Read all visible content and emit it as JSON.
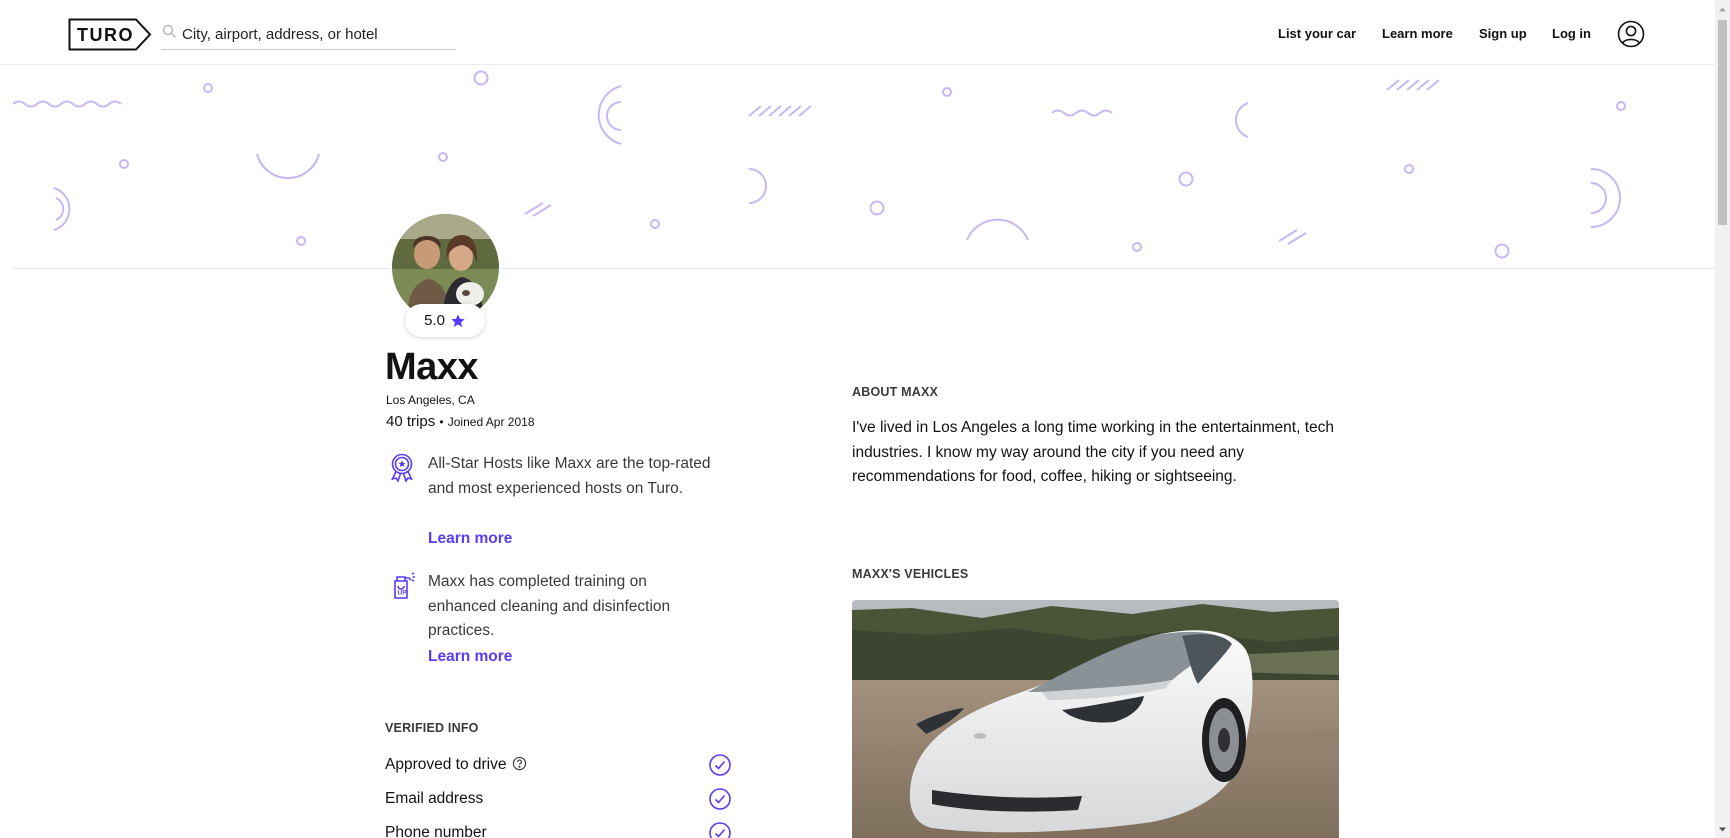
{
  "header": {
    "logo_text": "TURO",
    "search_placeholder": "City, airport, address, or hotel",
    "nav": {
      "list_car": "List your car",
      "learn_more": "Learn more",
      "sign_up": "Sign up",
      "log_in": "Log in"
    }
  },
  "host": {
    "rating": "5.0",
    "name": "Maxx",
    "location": "Los Angeles, CA",
    "trips": "40 trips",
    "separator": "•",
    "joined": "Joined Apr 2018",
    "badges": [
      {
        "icon": "all-star-ribbon-icon",
        "text": "All-Star Hosts like Maxx are the top-rated and most experienced hosts on Turo.",
        "link": "Learn more"
      },
      {
        "icon": "cleaning-spray-icon",
        "text": "Maxx has completed training on enhanced cleaning and disinfection practices.",
        "link": "Learn more"
      }
    ]
  },
  "verified": {
    "label": "VERIFIED INFO",
    "items": [
      {
        "label": "Approved to drive",
        "has_help": true
      },
      {
        "label": "Email address",
        "has_help": false
      },
      {
        "label": "Phone number",
        "has_help": false
      }
    ]
  },
  "about": {
    "label": "ABOUT MAXX",
    "text": "I've lived in Los Angeles a long time working in the entertainment, tech industries. I know my way around the city if you need any recommendations for food, coffee, hiking or sightseeing."
  },
  "vehicles": {
    "label": "MAXX'S VEHICLES"
  },
  "colors": {
    "accent": "#593cfb",
    "banner_shapes": "#c8b6f5",
    "text": "#121214"
  }
}
